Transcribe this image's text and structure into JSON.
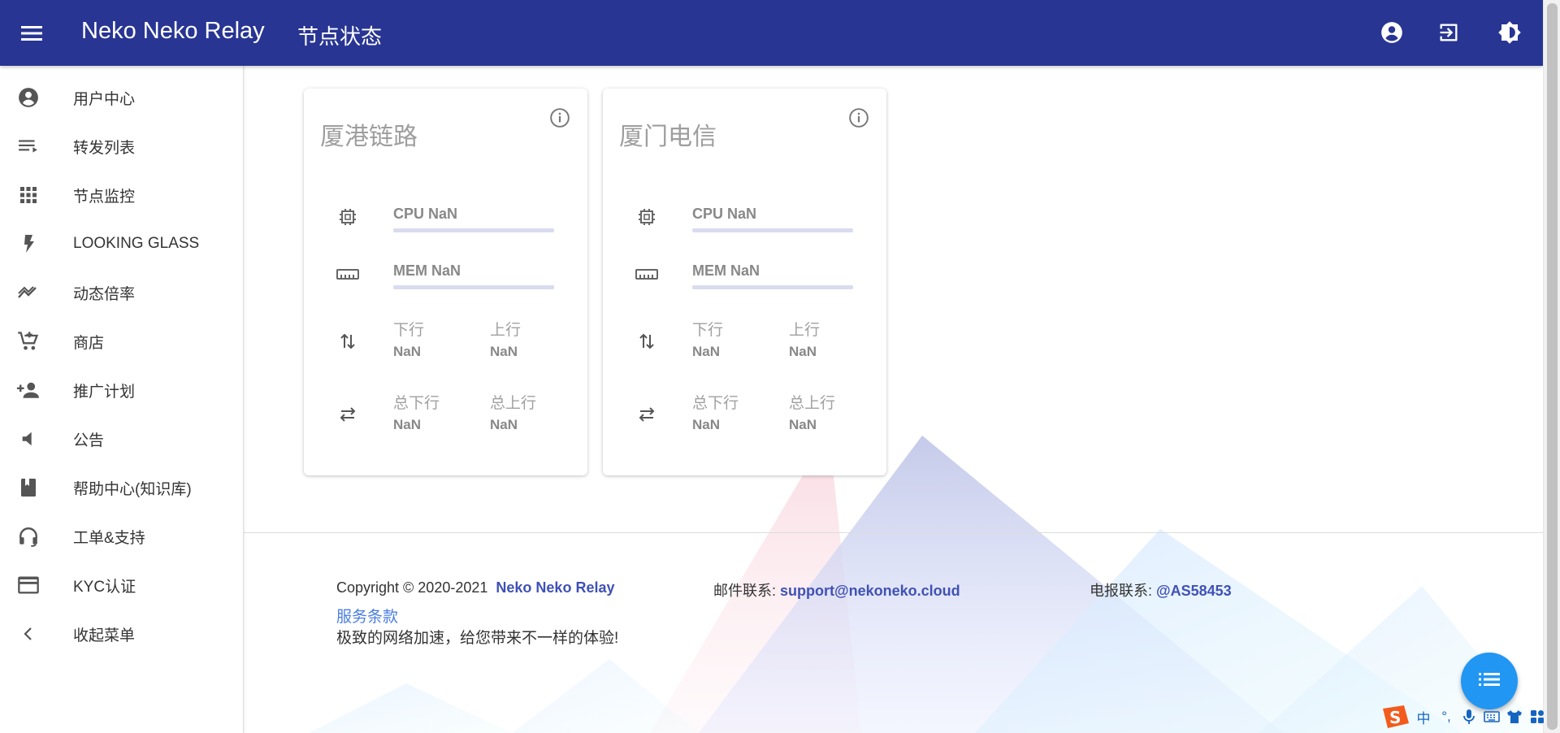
{
  "header": {
    "app_title": "Neko Neko Relay",
    "page_title": "节点状态",
    "icons": [
      "menu-icon",
      "account-icon",
      "logout-icon",
      "brightness-icon"
    ]
  },
  "sidebar": {
    "items": [
      {
        "label": "用户中心",
        "icon": "account-circle-icon"
      },
      {
        "label": "转发列表",
        "icon": "playlist-icon"
      },
      {
        "label": "节点监控",
        "icon": "grid-icon"
      },
      {
        "label": "LOOKING GLASS",
        "icon": "flash-icon"
      },
      {
        "label": "动态倍率",
        "icon": "trend-icon"
      },
      {
        "label": "商店",
        "icon": "cart-plus-icon"
      },
      {
        "label": "推广计划",
        "icon": "person-add-icon"
      },
      {
        "label": "公告",
        "icon": "volume-icon"
      },
      {
        "label": "帮助中心(知识库)",
        "icon": "book-icon"
      },
      {
        "label": "工单&支持",
        "icon": "headset-icon"
      },
      {
        "label": "KYC认证",
        "icon": "credit-card-icon"
      },
      {
        "label": "收起菜单",
        "icon": "chevron-left-icon"
      }
    ]
  },
  "nodes": [
    {
      "name": "厦港链路",
      "cpu_label": "CPU NaN",
      "mem_label": "MEM NaN",
      "cpu_level": 0,
      "mem_level": 0,
      "down_label": "下行",
      "down_value": "NaN",
      "up_label": "上行",
      "up_value": "NaN",
      "total_down_label": "总下行",
      "total_down_value": "NaN",
      "total_up_label": "总上行",
      "total_up_value": "NaN"
    },
    {
      "name": "厦门电信",
      "cpu_label": "CPU NaN",
      "mem_label": "MEM NaN",
      "cpu_level": 0,
      "mem_level": 0,
      "down_label": "下行",
      "down_value": "NaN",
      "up_label": "上行",
      "up_value": "NaN",
      "total_down_label": "总下行",
      "total_down_value": "NaN",
      "total_up_label": "总上行",
      "total_up_value": "NaN"
    }
  ],
  "footer": {
    "copyright": "Copyright © 2020-2021",
    "brand_link": "Neko Neko Relay",
    "email_label": "邮件联系:",
    "email": "support@nekoneko.cloud",
    "telegram_label": "电报联系:",
    "telegram": "@AS58453",
    "slogan": "极致的网络加速，给您带来不一样的体验!",
    "terms": "服务条款"
  },
  "ime": {
    "lang": "中",
    "punct": "°,"
  },
  "colors": {
    "primary": "#283593",
    "accent": "#3f51b5",
    "fab": "#2196f3",
    "bar_track": "#d9dcef"
  }
}
